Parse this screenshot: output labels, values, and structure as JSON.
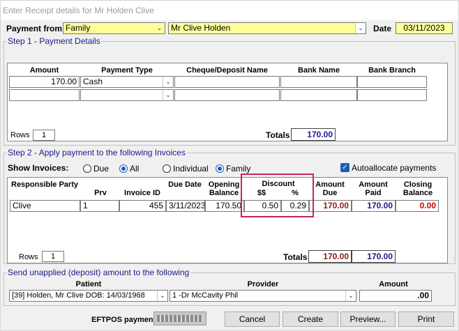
{
  "window": {
    "title": "Enter Receipt details for Mr  Holden  Clive"
  },
  "header": {
    "payment_from_label": "Payment from",
    "payment_from_value": "Family",
    "payer_value": "Mr Clive  Holden",
    "date_label": "Date",
    "date_value": "03/11/2023"
  },
  "step1": {
    "title": "Step 1 - Payment Details",
    "columns": [
      "Amount",
      "Payment Type",
      "Cheque/Deposit Name",
      "Bank Name",
      "Bank Branch"
    ],
    "rows": [
      {
        "amount": "170.00",
        "type": "Cash",
        "cheque": "",
        "bank": "",
        "branch": ""
      },
      {
        "amount": "",
        "type": "",
        "cheque": "",
        "bank": "",
        "branch": ""
      }
    ],
    "rows_label": "Rows",
    "rows_value": "1",
    "totals_label": "Totals",
    "totals_value": "170.00"
  },
  "step2": {
    "title": "Step 2 - Apply payment to the following Invoices",
    "show_label": "Show Invoices:",
    "radio_due": "Due",
    "radio_all": "All",
    "radio_individual": "Individual",
    "radio_family": "Family",
    "autoallocate_label": "Autoallocate payments",
    "headers": {
      "party": "Responsible Party",
      "prv": "Prv",
      "invoice": "Invoice ID",
      "due_date": "Due Date",
      "opening": "Opening Balance",
      "discount": "Discount",
      "disc_dollars": "$$",
      "disc_pct": "%",
      "amount_due": "Amount Due",
      "amount_paid": "Amount Paid",
      "closing": "Closing Balance"
    },
    "row": {
      "party": "Clive",
      "prv": "1",
      "invoice": "455",
      "due_date": "3/11/2023",
      "opening": "170.50",
      "disc_dollars": "0.50",
      "disc_pct": "0.29",
      "amount_due": "170.00",
      "amount_paid": "170.00",
      "closing": "0.00"
    },
    "rows_label": "Rows",
    "rows_value": "1",
    "totals_label": "Totals",
    "totals_due": "170.00",
    "totals_paid": "170.00"
  },
  "step3": {
    "title": "Send unapplied (deposit) amount to the following",
    "patient_label": "Patient",
    "provider_label": "Provider",
    "amount_label": "Amount",
    "patient_value": "[39] Holden, Mr Clive DOB: 14/03/1968",
    "provider_value": "1 -Dr McCavity Phil",
    "amount_value": ".00"
  },
  "footer": {
    "eftpos_label": "EFTPOS payment",
    "eftpos_button": "",
    "cancel": "Cancel",
    "create": "Create",
    "preview": "Preview...",
    "print": "Print"
  }
}
